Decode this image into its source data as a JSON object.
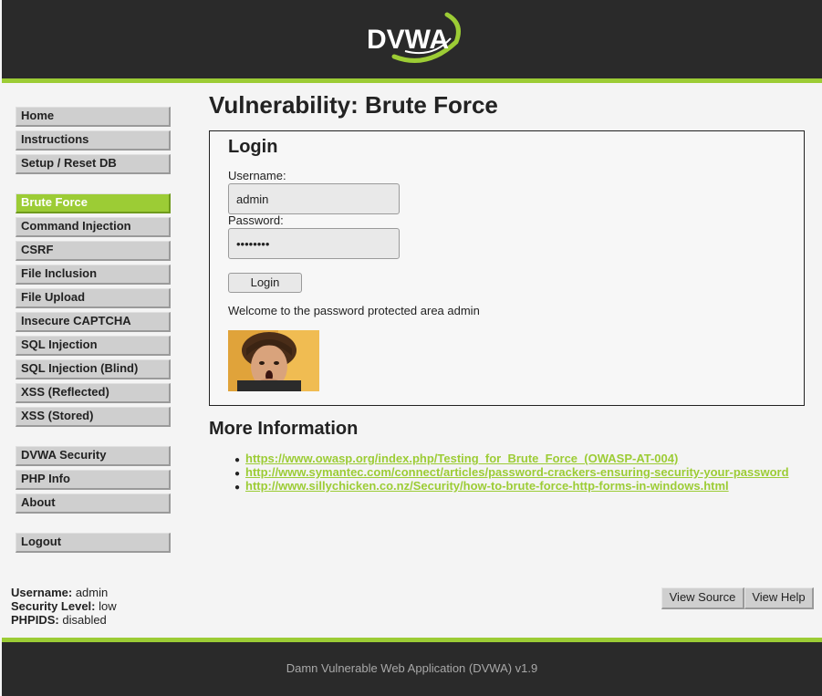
{
  "header": {
    "logo_text": "DVWA"
  },
  "menu": {
    "group1": [
      "Home",
      "Instructions",
      "Setup / Reset DB"
    ],
    "group2": [
      "Brute Force",
      "Command Injection",
      "CSRF",
      "File Inclusion",
      "File Upload",
      "Insecure CAPTCHA",
      "SQL Injection",
      "SQL Injection (Blind)",
      "XSS (Reflected)",
      "XSS (Stored)"
    ],
    "group3": [
      "DVWA Security",
      "PHP Info",
      "About"
    ],
    "group4": [
      "Logout"
    ],
    "selected": "Brute Force"
  },
  "main": {
    "title": "Vulnerability: Brute Force",
    "login": {
      "heading": "Login",
      "username_label": "Username:",
      "username_value": "admin",
      "password_label": "Password:",
      "password_value": "password",
      "button": "Login",
      "welcome": "Welcome to the password protected area admin"
    },
    "more_info": {
      "heading": "More Information",
      "links": [
        "https://www.owasp.org/index.php/Testing_for_Brute_Force_(OWASP-AT-004)",
        "http://www.symantec.com/connect/articles/password-crackers-ensuring-security-your-password",
        "http://www.sillychicken.co.nz/Security/how-to-brute-force-http-forms-in-windows.html"
      ]
    }
  },
  "status": {
    "username_label": "Username:",
    "username": "admin",
    "security_label": "Security Level:",
    "security": "low",
    "phpids_label": "PHPIDS:",
    "phpids": "disabled"
  },
  "buttons": {
    "view_source": "View Source",
    "view_help": "View Help"
  },
  "footer": {
    "text": "Damn Vulnerable Web Application (DVWA) v1.9"
  },
  "colors": {
    "accent": "#9ccc35",
    "header_bg": "#2a2a2a",
    "menu_bg": "#cfcfcf"
  }
}
